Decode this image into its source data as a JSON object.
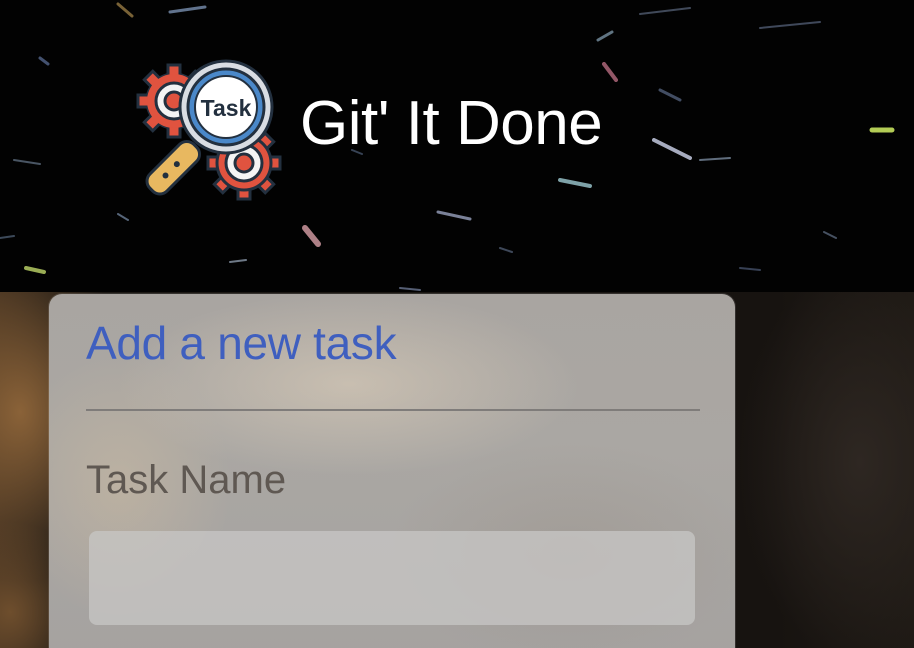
{
  "header": {
    "app_title": "Git' It Done",
    "logo": {
      "icon": "magnifier-gears-logo-icon",
      "badge_text": "Task"
    },
    "background_color": "#020202"
  },
  "card": {
    "title": "Add a new task",
    "fields": {
      "task_name": {
        "label": "Task Name",
        "value": "",
        "placeholder": ""
      }
    }
  },
  "colors": {
    "title_blue": "#3f5fbf",
    "label_gray": "#5f5852",
    "card_gray": "#a9a5a1",
    "gear_red": "#e0533f",
    "lens_blue": "#4a88c9",
    "handle_orange": "#e8b860"
  }
}
